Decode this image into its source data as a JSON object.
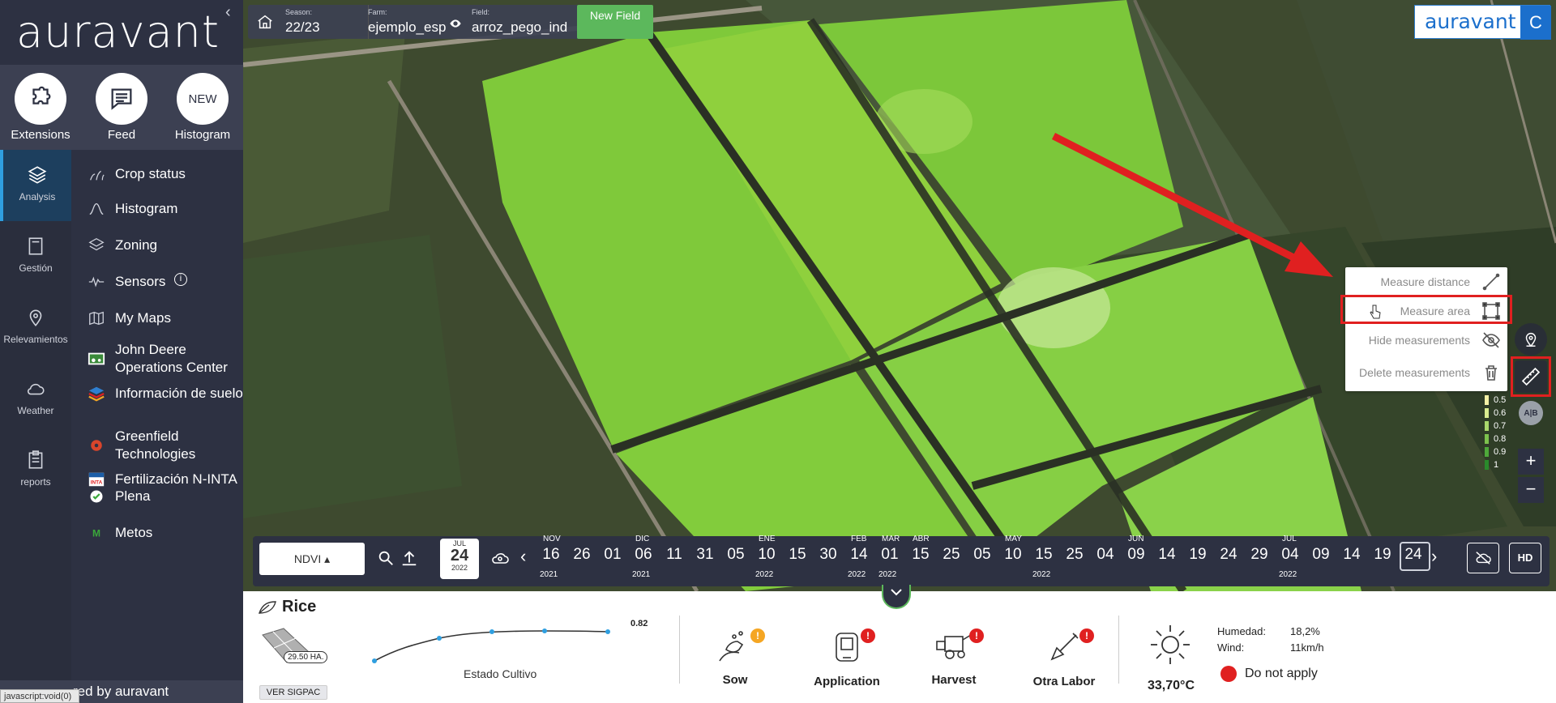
{
  "sidebar": {
    "brand": "auravant",
    "quick": [
      {
        "label": "Extensions",
        "icon": "puzzle-icon"
      },
      {
        "label": "Feed",
        "icon": "chat-icon"
      },
      {
        "label": "Histogram",
        "circle_text": "NEW"
      }
    ],
    "rail": [
      {
        "label": "Analysis",
        "icon": "layers-icon"
      },
      {
        "label": "Gestión",
        "icon": "notebook-icon"
      },
      {
        "label": "Relevamientos",
        "icon": "pin-icon"
      },
      {
        "label": "Weather",
        "icon": "cloud-icon"
      },
      {
        "label": "reports",
        "icon": "clipboard-icon"
      }
    ],
    "menu": [
      {
        "label": "Crop status"
      },
      {
        "label": "Histogram"
      },
      {
        "label": "Zoning"
      },
      {
        "label": "Sensors",
        "info": "i"
      },
      {
        "label": "My Maps"
      },
      {
        "label": "John Deere Operations Center"
      },
      {
        "label": "Información de suelo"
      },
      {
        "label": "Greenfield Technologies"
      },
      {
        "label": "Fertilización N-INTA"
      },
      {
        "label": "Plena"
      },
      {
        "label": "Metos"
      }
    ],
    "powered_by": "red by auravant",
    "status_url": "javascript:void(0)"
  },
  "topbar": {
    "season_label": "Season:",
    "season": "22/23",
    "farm_label": "Farm:",
    "farm": "ejemplo_esp",
    "field_label": "Field:",
    "field": "arroz_pego_ind",
    "new_field": "New Field"
  },
  "brand_box": {
    "text": "auravant",
    "letter": "C"
  },
  "measure_menu": {
    "items": [
      {
        "label": "Measure distance",
        "icon": "line-measure-icon"
      },
      {
        "label": "Measure area",
        "icon": "area-measure-icon"
      },
      {
        "label": "Hide measurements",
        "icon": "eye-off-icon"
      },
      {
        "label": "Delete measurements",
        "icon": "trash-icon"
      }
    ]
  },
  "legend": {
    "values": [
      "0.5",
      "0.6",
      "0.7",
      "0.8",
      "0.9",
      "1"
    ],
    "colors": [
      "#f4f1a6",
      "#d9ec8f",
      "#a9d86b",
      "#7cc24d",
      "#4ea83a",
      "#2a8a2b"
    ]
  },
  "zoom": {
    "in": "+",
    "out": "−"
  },
  "timeline": {
    "index": "NDVI",
    "selected": {
      "month": "JUL",
      "day": "24",
      "year": "2022"
    },
    "months": [
      {
        "label": "NOV"
      },
      {
        "label": "DIC"
      },
      {
        "label": "ENE"
      },
      {
        "label": "FEB"
      },
      {
        "label": "MAR"
      },
      {
        "label": "ABR"
      },
      {
        "label": "MAY"
      },
      {
        "label": "JUN"
      },
      {
        "label": "JUL"
      }
    ],
    "days": [
      "16",
      "26",
      "01",
      "06",
      "11",
      "31",
      "05",
      "10",
      "15",
      "30",
      "14",
      "01",
      "15",
      "25",
      "05",
      "10",
      "15",
      "25",
      "04",
      "09",
      "14",
      "19",
      "24",
      "29",
      "04",
      "09",
      "14",
      "19",
      "24"
    ],
    "years": [
      {
        "label": "2021"
      },
      {
        "label": "2021"
      },
      {
        "label": "2022"
      },
      {
        "label": "2022"
      },
      {
        "label": "2022"
      },
      {
        "label": "2022"
      },
      {
        "label": "2022"
      }
    ],
    "hd": "HD"
  },
  "bottom": {
    "crop": "Rice",
    "area": "29.50 HA.",
    "sigpac": "VER SIGPAC",
    "curve_value": "0.82",
    "curve_label": "Estado Cultivo",
    "actions": [
      {
        "label": "Sow",
        "icon": "sow-icon",
        "warn_color": "#f5a623"
      },
      {
        "label": "Application",
        "icon": "sprayer-icon",
        "warn_color": "#e02020"
      },
      {
        "label": "Harvest",
        "icon": "harvester-icon",
        "warn_color": "#e02020"
      },
      {
        "label": "Otra Labor",
        "icon": "shovel-icon",
        "warn_color": "#e02020"
      }
    ],
    "temperature": "33,70°C",
    "humidity_label": "Humedad:",
    "humidity": "18,2%",
    "wind_label": "Wind:",
    "wind": "11km/h",
    "apply_status": "Do not apply",
    "apply_color": "#e02020"
  }
}
